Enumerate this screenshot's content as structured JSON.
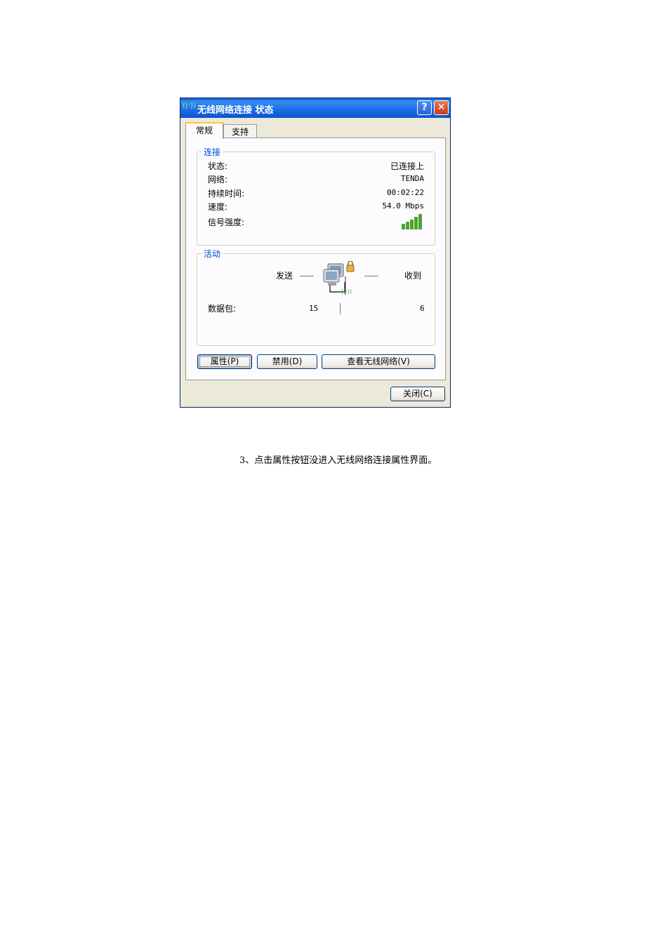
{
  "window": {
    "title": "无线网络连接 状态",
    "help_glyph": "?",
    "close_glyph": "✕",
    "title_icon_glyph": "((·))"
  },
  "tabs": [
    {
      "label": "常规",
      "active": true
    },
    {
      "label": "支持",
      "active": false
    }
  ],
  "connection": {
    "legend": "连接",
    "rows": [
      {
        "label": "状态:",
        "value": "已连接上"
      },
      {
        "label": "网络:",
        "value": "TENDA"
      },
      {
        "label": "持续时间:",
        "value": "00:02:22"
      },
      {
        "label": "速度:",
        "value": "54.0 Mbps"
      }
    ],
    "signal_label": "信号强度:",
    "signal_bars_lit": 5,
    "signal_bars_total": 5,
    "signal_color": "#4da234"
  },
  "activity": {
    "legend": "活动",
    "sent_label": "发送",
    "received_label": "收到",
    "packets_label": "数据包:",
    "packets_sent": "15",
    "packets_received": "6"
  },
  "buttons": {
    "properties": "属性(P)",
    "disable": "禁用(D)",
    "view_networks": "查看无线网络(V)",
    "close": "关闭(C)"
  },
  "caption": "3、点击属性按钮没进入无线网络连接属性界面。",
  "colors": {
    "titlebar": "#1c6ee8",
    "legend_text": "#0046d5",
    "dialog_bg": "#ece9d8",
    "close_button": "#c93a17"
  }
}
